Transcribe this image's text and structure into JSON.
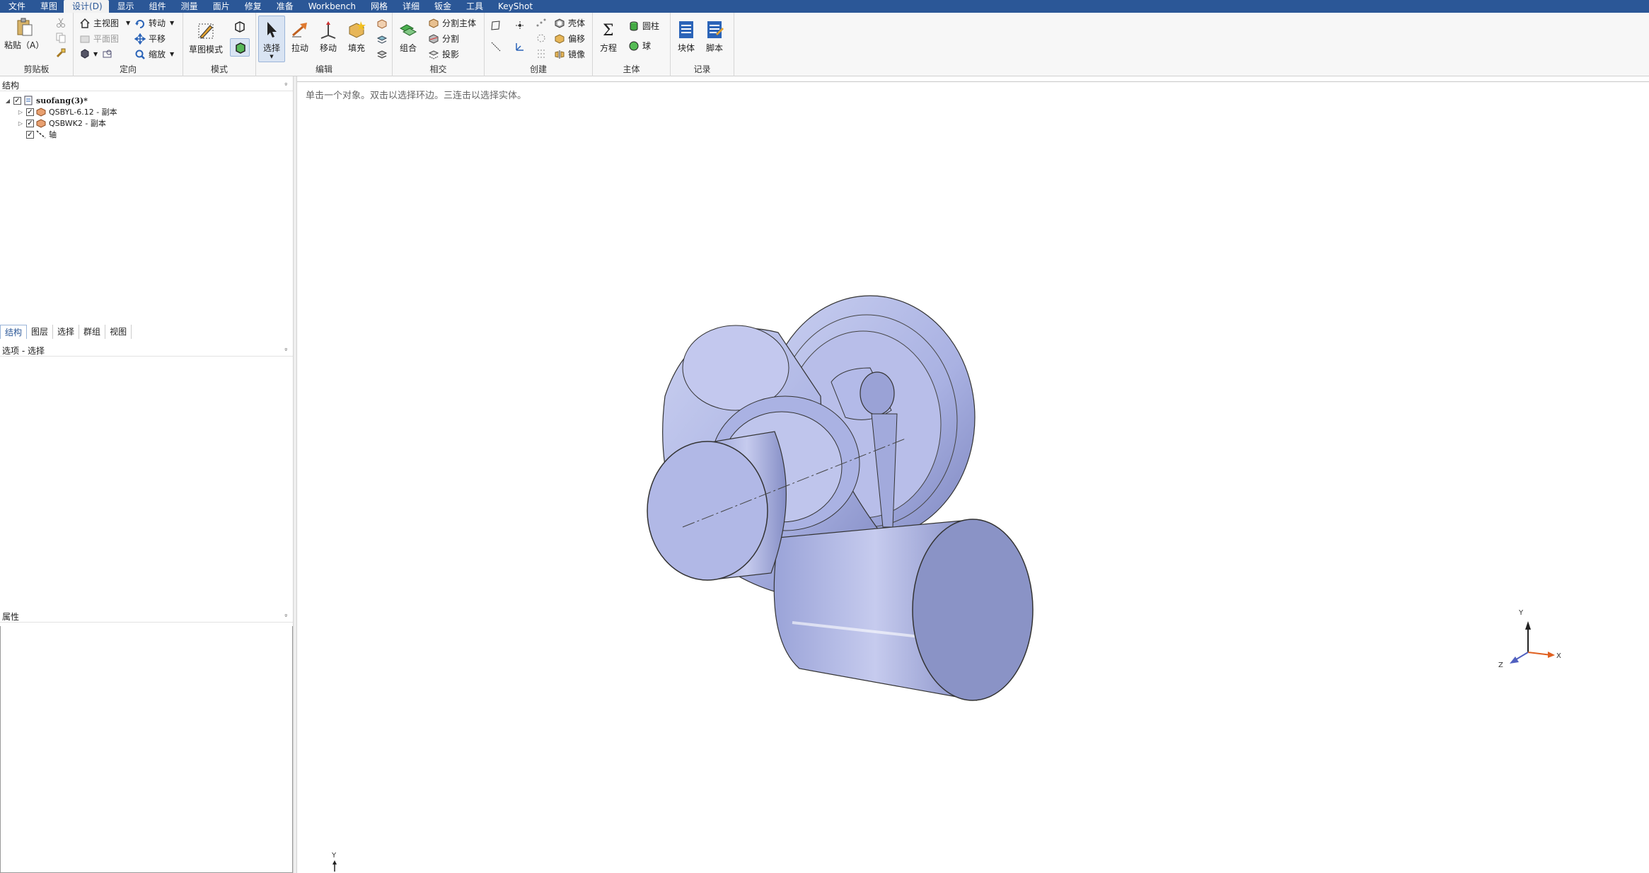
{
  "menu": [
    "文件",
    "草图",
    "设计(D)",
    "显示",
    "组件",
    "测量",
    "面片",
    "修复",
    "准备",
    "Workbench",
    "网格",
    "详细",
    "钣金",
    "工具",
    "KeyShot"
  ],
  "ribbon": {
    "clipboard": {
      "paste": "粘贴（A）",
      "label": "剪贴板"
    },
    "orient": {
      "home": "主视图",
      "plane": "平面图",
      "spin": "转动",
      "pan": "平移",
      "zoom": "缩放",
      "label": "定向"
    },
    "mode": {
      "sketch": "草图模式",
      "label": "模式"
    },
    "edit": {
      "select": "选择",
      "pull": "拉动",
      "move": "移动",
      "fill": "填充",
      "label": "编辑"
    },
    "intersect": {
      "combine": "组合",
      "split_body": "分割主体",
      "split": "分割",
      "project": "投影",
      "label": "相交"
    },
    "create": {
      "shell": "壳体",
      "offset": "偏移",
      "mirror": "镜像",
      "label": "创建"
    },
    "body": {
      "equation": "方程",
      "cylinder": "圆柱",
      "sphere": "球",
      "label": "主体"
    },
    "record": {
      "block": "块体",
      "script": "脚本",
      "label": "记录"
    }
  },
  "structure": {
    "title": "结构",
    "root": "suofang(3)*",
    "items": [
      "QSBYL-6.12 - 副本",
      "QSBWK2 - 副本",
      "轴"
    ]
  },
  "tabs": [
    "结构",
    "图层",
    "选择",
    "群组",
    "视图"
  ],
  "options_title": "选项 - 选择",
  "properties_title": "属性",
  "viewport": {
    "hint": "单击一个对象。双击以选择环边。三连击以选择实体。",
    "triad": {
      "x": "X",
      "y": "Y",
      "z": "Z"
    },
    "corner_axis": "Y"
  },
  "colors": {
    "menubar": "#2b5797",
    "body": "#aab3e3",
    "body_dark": "#7f88c0",
    "face": "#8a93c6"
  }
}
